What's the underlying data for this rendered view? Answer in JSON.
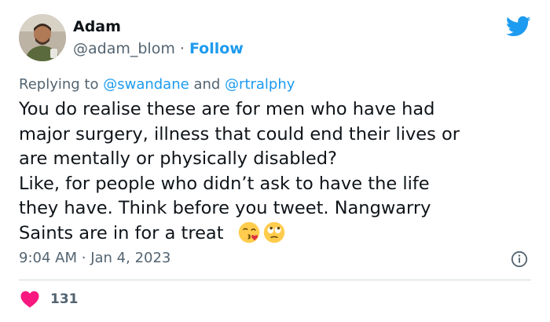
{
  "author": {
    "name": "Adam",
    "handle": "@adam_blom",
    "separator": "·",
    "follow_label": "Follow"
  },
  "reply_context": {
    "prefix": "Replying to",
    "mention_1": "@swandane",
    "conjunction": "and",
    "mention_2": "@rtralphy"
  },
  "tweet": {
    "lines": [
      "You do realise these are for men who have had",
      "major surgery, illness that could end their lives or",
      "are mentally or physically disabled?",
      "Like, for people who didn’t ask to have the life",
      "they have. Think before you tweet. Nangwarry",
      "Saints are in for a treat"
    ],
    "emojis": [
      "face-blowing-kiss",
      "face-with-rolling-eyes"
    ]
  },
  "meta": {
    "time": "9:04 AM",
    "separator": "·",
    "date": "Jan 4, 2023"
  },
  "engagement": {
    "likes": "131"
  },
  "colors": {
    "accent": "#1d9bf0",
    "text": "#0f1419",
    "secondary": "#536471",
    "like": "#f91880",
    "divider": "#cfd9de"
  },
  "icons": {
    "brand": "twitter-bird-icon",
    "info": "info-icon",
    "like": "heart-icon"
  }
}
